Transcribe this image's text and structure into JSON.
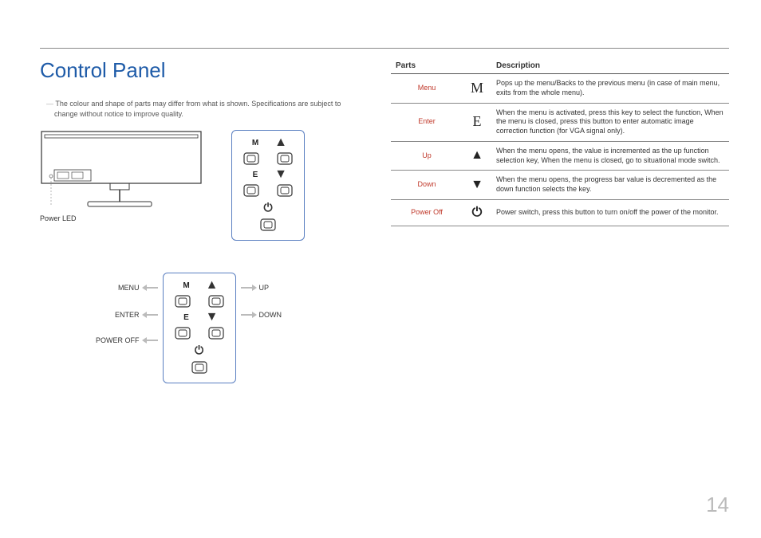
{
  "title": "Control Panel",
  "note": "The colour and shape of parts may differ from what is shown. Specifications are subject to change without notice to improve quality.",
  "powerLedLabel": "Power LED",
  "labeledButtons": {
    "left": [
      "MENU",
      "ENTER",
      "POWER OFF"
    ],
    "right": [
      "UP",
      "DOWN"
    ]
  },
  "table": {
    "headers": {
      "parts": "Parts",
      "description": "Description"
    },
    "rows": [
      {
        "part": "Menu",
        "symbol_letter": "M",
        "desc": "Pops up the menu/Backs to the previous menu (in case of main menu, exits from the whole menu)."
      },
      {
        "part": "Enter",
        "symbol_letter": "E",
        "desc": "When the menu is activated, press this key to select the function, When the menu is closed, press this button to enter automatic image correction function (for VGA signal only)."
      },
      {
        "part": "Up",
        "symbol_tri": "up",
        "desc": "When the menu opens, the value is incremented as the up function selection key, When the menu is closed, go to situational mode switch."
      },
      {
        "part": "Down",
        "symbol_tri": "down",
        "desc": "When the menu opens, the progress bar value is decremented as the down function selects the key."
      },
      {
        "part": "Power Off",
        "symbol_power": true,
        "desc": "Power switch, press this button to turn on/off the power of the monitor."
      }
    ]
  },
  "pageNumber": "14"
}
